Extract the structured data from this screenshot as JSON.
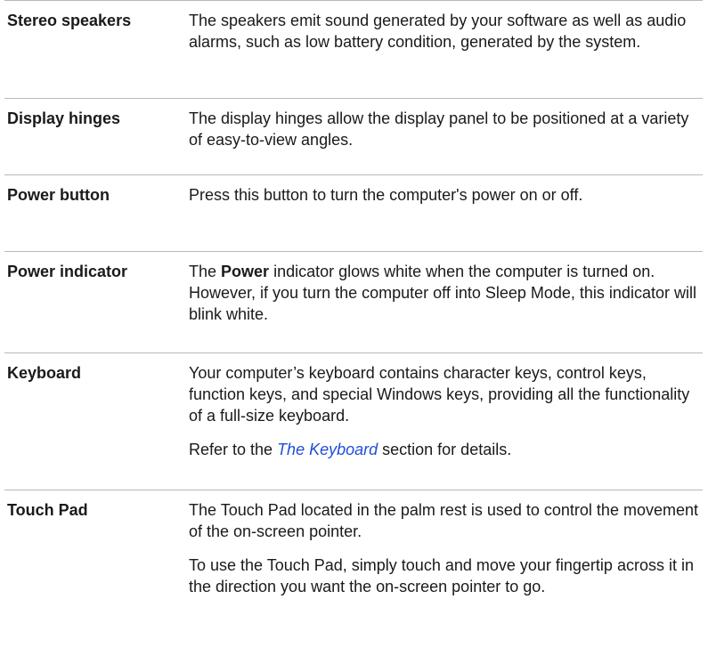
{
  "rows": [
    {
      "term": "Stereo speakers",
      "desc": [
        {
          "text": "The speakers emit sound generated by your software as well as audio alarms, such as low battery condition, generated by the system."
        }
      ]
    },
    {
      "term": "Display hinges",
      "desc": [
        {
          "text": "The display hinges allow the display panel to be positioned at a variety of easy-to-view angles."
        }
      ]
    },
    {
      "term": "Power button",
      "desc": [
        {
          "text": "Press this button to turn the computer's power on or off."
        }
      ]
    },
    {
      "term": "Power indicator",
      "desc": [
        {
          "pre": "The ",
          "bold": "Power",
          "post": " indicator glows white when the computer is turned on. However, if you turn the computer off into Sleep Mode, this indicator will blink white."
        }
      ]
    },
    {
      "term": "Keyboard",
      "desc": [
        {
          "text": "Your computer’s keyboard contains character keys, control keys, function keys, and special Windows keys, providing all the functionality of a full-size keyboard."
        },
        {
          "pre": "Refer to the ",
          "link": "The Keyboard",
          "post": " section for details."
        }
      ]
    },
    {
      "term": "Touch Pad",
      "desc": [
        {
          "text": "The Touch Pad located in the palm rest is used to control the movement of the on-screen pointer."
        },
        {
          "text": "To use the Touch Pad, simply touch and move your fingertip across it in the direction you want the on-screen pointer to go."
        }
      ]
    }
  ]
}
